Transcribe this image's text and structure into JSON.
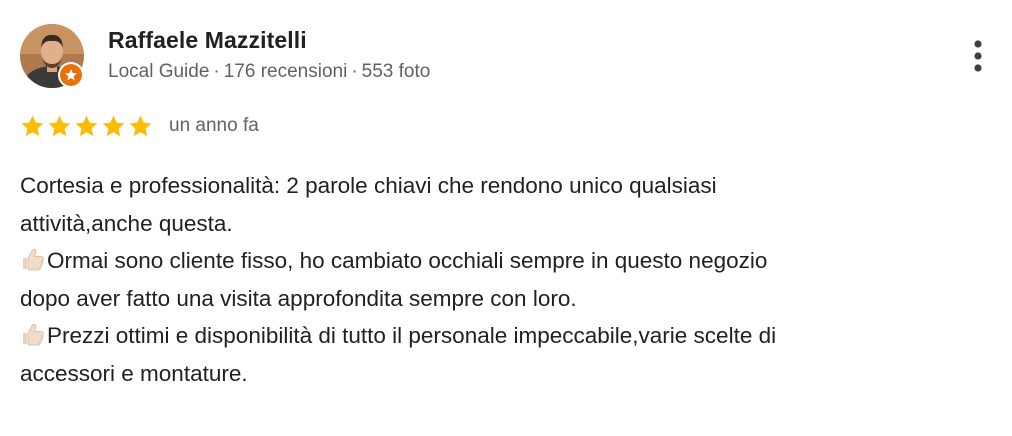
{
  "reviewer": {
    "name": "Raffaele Mazzitelli",
    "badge": "Local Guide",
    "reviews_count": "176 recensioni",
    "photos_count": "553 foto",
    "separator": "·",
    "avatar_icon": "user-photo-avatar",
    "badge_icon": "local-guide-star-badge"
  },
  "rating": {
    "stars": 5,
    "max_stars": 5,
    "date": "un anno fa",
    "star_color": "#fbbc04"
  },
  "menu": {
    "icon": "more-vert-icon"
  },
  "review": {
    "lines": [
      {
        "icon": "",
        "text": "Cortesia e professionalità: 2 parole chiavi che rendono unico qualsiasi"
      },
      {
        "icon": "",
        "text": "attività,anche questa."
      },
      {
        "icon": "thumbs-up-icon",
        "text": "Ormai sono cliente fisso, ho cambiato occhiali sempre in questo negozio"
      },
      {
        "icon": "",
        "text": "dopo aver fatto una visita approfondita sempre con loro."
      },
      {
        "icon": "thumbs-up-icon",
        "text": "Prezzi ottimi e disponibilità di tutto il personale impeccabile,varie scelte di"
      },
      {
        "icon": "",
        "text": "accessori e montature."
      }
    ]
  },
  "colors": {
    "text_primary": "#202124",
    "text_secondary": "#5f6368",
    "badge_orange": "#e8710a",
    "star_gold": "#fbbc04"
  }
}
